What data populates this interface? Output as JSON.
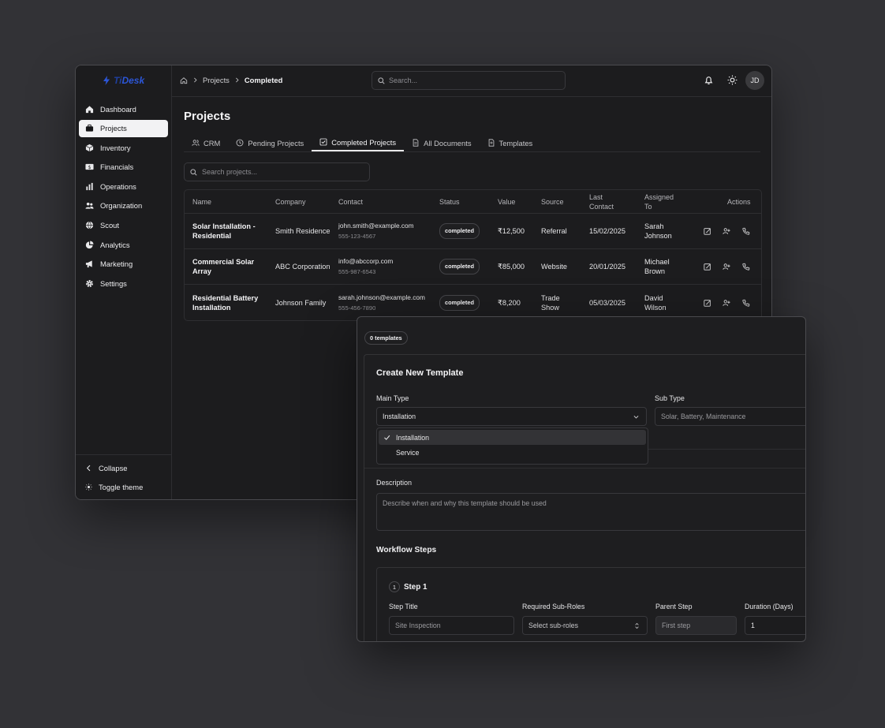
{
  "app": {
    "logo_pre": "Ti",
    "logo_post": "Desk",
    "brand_color": "#2c56d8"
  },
  "sidebar": {
    "items": [
      {
        "label": "Dashboard",
        "icon": "home-icon"
      },
      {
        "label": "Projects",
        "icon": "briefcase-icon",
        "active": true
      },
      {
        "label": "Inventory",
        "icon": "box-icon"
      },
      {
        "label": "Financials",
        "icon": "dollar-icon"
      },
      {
        "label": "Operations",
        "icon": "bar-chart-icon"
      },
      {
        "label": "Organization",
        "icon": "users-icon"
      },
      {
        "label": "Scout",
        "icon": "globe-icon"
      },
      {
        "label": "Analytics",
        "icon": "pie-chart-icon"
      },
      {
        "label": "Marketing",
        "icon": "megaphone-icon"
      },
      {
        "label": "Settings",
        "icon": "gear-icon"
      }
    ],
    "collapse": "Collapse",
    "toggle_theme": "Toggle theme"
  },
  "topbar": {
    "crumb1": "Projects",
    "crumb2": "Completed",
    "search_placeholder": "Search...",
    "avatar": "JD"
  },
  "page": {
    "title": "Projects",
    "tabs": [
      "CRM",
      "Pending Projects",
      "Completed Projects",
      "All Documents",
      "Templates"
    ],
    "active_tab": 2,
    "search_placeholder": "Search projects..."
  },
  "table": {
    "headers": [
      "Name",
      "Company",
      "Contact",
      "Status",
      "Value",
      "Source",
      "Last Contact",
      "Assigned To",
      "Actions"
    ],
    "rows": [
      {
        "name": "Solar Installation - Residential",
        "company": "Smith Residence",
        "email": "john.smith@example.com",
        "phone": "555-123-4567",
        "status": "completed",
        "value": "₹12,500",
        "source": "Referral",
        "last_contact": "15/02/2025",
        "assigned": "Sarah Johnson"
      },
      {
        "name": "Commercial Solar Array",
        "company": "ABC Corporation",
        "email": "info@abccorp.com",
        "phone": "555-987-6543",
        "status": "completed",
        "value": "₹85,000",
        "source": "Website",
        "last_contact": "20/01/2025",
        "assigned": "Michael Brown"
      },
      {
        "name": "Residential Battery Installation",
        "company": "Johnson Family",
        "email": "sarah.johnson@example.com",
        "phone": "555-456-7890",
        "status": "completed",
        "value": "₹8,200",
        "source": "Trade Show",
        "last_contact": "05/03/2025",
        "assigned": "David Wilson"
      }
    ]
  },
  "template_panel": {
    "count_badge": "0 templates",
    "title": "Create New Template",
    "main_type_label": "Main Type",
    "main_type_value": "Installation",
    "main_type_options": [
      "Installation",
      "Service"
    ],
    "sub_type_label": "Sub Type",
    "sub_type_placeholder": "Solar, Battery, Maintenance",
    "description_label": "Description",
    "description_placeholder": "Describe when and why this template should be used",
    "workflow_label": "Workflow Steps",
    "step": {
      "number": "1",
      "title": "Step 1",
      "step_title_label": "Step Title",
      "step_title_placeholder": "Site Inspection",
      "roles_label": "Required Sub-Roles",
      "roles_placeholder": "Select sub-roles",
      "parent_label": "Parent Step",
      "parent_value": "First step",
      "duration_label": "Duration (Days)",
      "duration_value": "1"
    }
  }
}
